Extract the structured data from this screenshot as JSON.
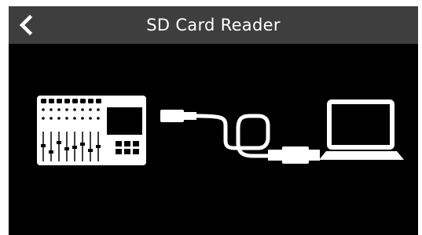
{
  "header": {
    "title": "SD Card Reader",
    "back_icon": "chevron-left-icon"
  },
  "illustration": {
    "items": [
      "mixer-recorder-device-icon",
      "usb-cable-icon",
      "laptop-icon"
    ]
  },
  "colors": {
    "header_bg": "#3e3e3e",
    "screen_bg": "#000000",
    "icon_fill": "#ffffff",
    "text": "#ffffff"
  }
}
